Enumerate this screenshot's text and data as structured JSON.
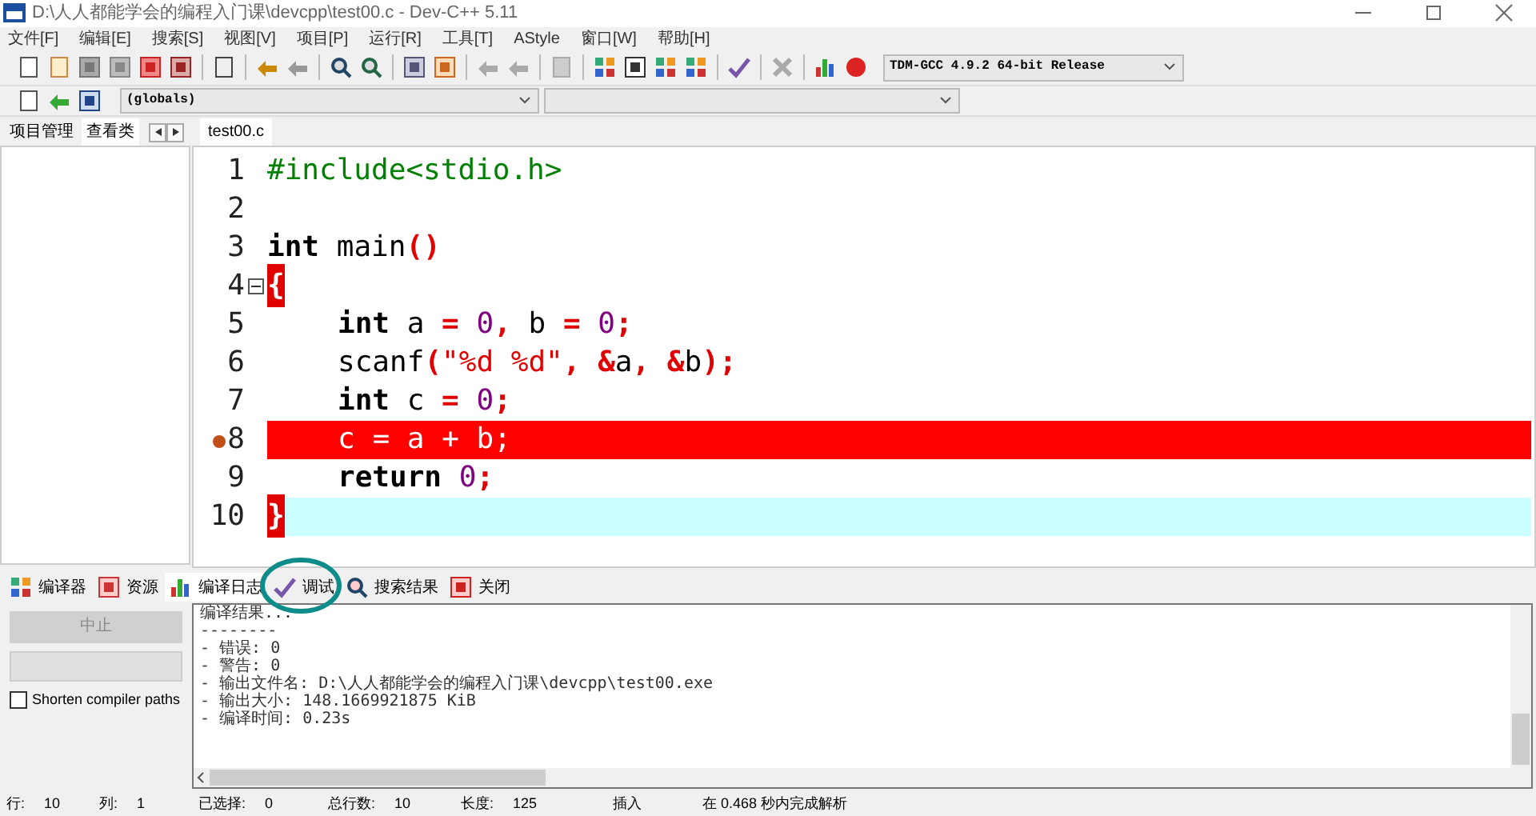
{
  "window": {
    "title": "D:\\人人都能学会的编程入门课\\devcpp\\test00.c - Dev-C++ 5.11"
  },
  "menu": [
    "文件[F]",
    "编辑[E]",
    "搜索[S]",
    "视图[V]",
    "项目[P]",
    "运行[R]",
    "工具[T]",
    "AStyle",
    "窗口[W]",
    "帮助[H]"
  ],
  "compiler_select": {
    "value": "TDM-GCC 4.9.2 64-bit Release"
  },
  "scope_select": {
    "value": "(globals)"
  },
  "left_tabs": [
    {
      "label": "项目管理",
      "selected": false
    },
    {
      "label": "查看类",
      "selected": true
    }
  ],
  "editor_tabs": [
    {
      "label": "test00.c",
      "selected": true
    }
  ],
  "code_lines": [
    {
      "number": "1",
      "current_line": false,
      "indented": false,
      "fold": false,
      "breakpoint": false,
      "tokens": [
        {
          "kind": "pp",
          "text": "#include<stdio.h>"
        }
      ]
    },
    {
      "number": "2",
      "current_line": false,
      "fold": false,
      "breakpoint": false
    },
    {
      "number": "3",
      "current_line": false,
      "indented": false,
      "fold": false,
      "breakpoint": false,
      "tokens": [
        {
          "kind": "kw",
          "text": "int"
        },
        {
          "kind": "id",
          "text": " main"
        },
        {
          "kind": "sym",
          "text": "()"
        }
      ]
    },
    {
      "number": "4",
      "current_line": false,
      "indented": false,
      "fold": true,
      "breakpoint": false,
      "tokens": [
        {
          "kind": "brace",
          "text": "{"
        }
      ]
    },
    {
      "number": "5",
      "current_line": false,
      "indented": true,
      "fold": false,
      "breakpoint": false,
      "tokens": [
        {
          "kind": "kw",
          "text": "int"
        },
        {
          "kind": "id",
          "text": " a "
        },
        {
          "kind": "sym",
          "text": "= "
        },
        {
          "kind": "num",
          "text": "0"
        },
        {
          "kind": "sym",
          "text": ", "
        },
        {
          "kind": "id",
          "text": "b "
        },
        {
          "kind": "sym",
          "text": "= "
        },
        {
          "kind": "num",
          "text": "0"
        },
        {
          "kind": "sym",
          "text": ";"
        }
      ]
    },
    {
      "number": "6",
      "current_line": false,
      "indented": true,
      "fold": false,
      "breakpoint": false,
      "tokens": [
        {
          "kind": "id",
          "text": "scanf"
        },
        {
          "kind": "sym",
          "text": "("
        },
        {
          "kind": "str",
          "text": "\"%d %d\""
        },
        {
          "kind": "sym",
          "text": ", &"
        },
        {
          "kind": "id",
          "text": "a"
        },
        {
          "kind": "sym",
          "text": ", &"
        },
        {
          "kind": "id",
          "text": "b"
        },
        {
          "kind": "sym",
          "text": ");"
        }
      ]
    },
    {
      "number": "7",
      "current_line": false,
      "indented": true,
      "fold": false,
      "breakpoint": false,
      "tokens": [
        {
          "kind": "kw",
          "text": "int"
        },
        {
          "kind": "id",
          "text": " c "
        },
        {
          "kind": "sym",
          "text": "= "
        },
        {
          "kind": "num",
          "text": "0"
        },
        {
          "kind": "sym",
          "text": ";"
        }
      ]
    },
    {
      "number": "8",
      "current_line": false,
      "indented": true,
      "fold": false,
      "breakpoint": true,
      "tokens": [
        {
          "kind": "id",
          "text": "c "
        },
        {
          "kind": "sym",
          "text": "= "
        },
        {
          "kind": "id",
          "text": "a "
        },
        {
          "kind": "sym",
          "text": "+ "
        },
        {
          "kind": "id",
          "text": "b"
        },
        {
          "kind": "sym",
          "text": ";"
        }
      ]
    },
    {
      "number": "9",
      "current_line": false,
      "indented": true,
      "fold": false,
      "breakpoint": false,
      "tokens": [
        {
          "kind": "kw",
          "text": "return "
        },
        {
          "kind": "num",
          "text": "0"
        },
        {
          "kind": "sym",
          "text": ";"
        }
      ]
    },
    {
      "number": "10",
      "current_line": true,
      "indented": false,
      "fold": false,
      "breakpoint": false,
      "tokens": [
        {
          "kind": "brace",
          "text": "}"
        }
      ]
    }
  ],
  "bottom_tabs": [
    {
      "label": "编译器",
      "selected": false,
      "circled": false
    },
    {
      "label": "资源",
      "selected": false,
      "circled": false
    },
    {
      "label": "编译日志",
      "selected": true,
      "circled": false
    },
    {
      "label": "调试",
      "selected": false,
      "circled": true
    },
    {
      "label": "搜索结果",
      "selected": false,
      "circled": false
    },
    {
      "label": "关闭",
      "selected": false,
      "circled": false
    }
  ],
  "progress": {
    "level": 0
  },
  "abort_button": {
    "label": "中止",
    "disabled": true
  },
  "shorten_paths": {
    "label": "Shorten compiler paths",
    "checked": false
  },
  "compile_log": [
    "编译结果...",
    "--------",
    "- 错误: 0",
    "- 警告: 0",
    "- 输出文件名: D:\\人人都能学会的编程入门课\\devcpp\\test00.exe",
    "- 输出大小: 148.1669921875 KiB",
    "- 编译时间: 0.23s"
  ],
  "status_bar": [
    {
      "label": "行:",
      "value": "10"
    },
    {
      "label": "列:",
      "value": "1"
    },
    {
      "label": "已选择:",
      "value": "0"
    },
    {
      "label": "总行数:",
      "value": "10"
    },
    {
      "label": "长度:",
      "value": "125"
    },
    {
      "label": "插入"
    },
    {
      "label": "在 0.468 秒内完成解析"
    }
  ]
}
